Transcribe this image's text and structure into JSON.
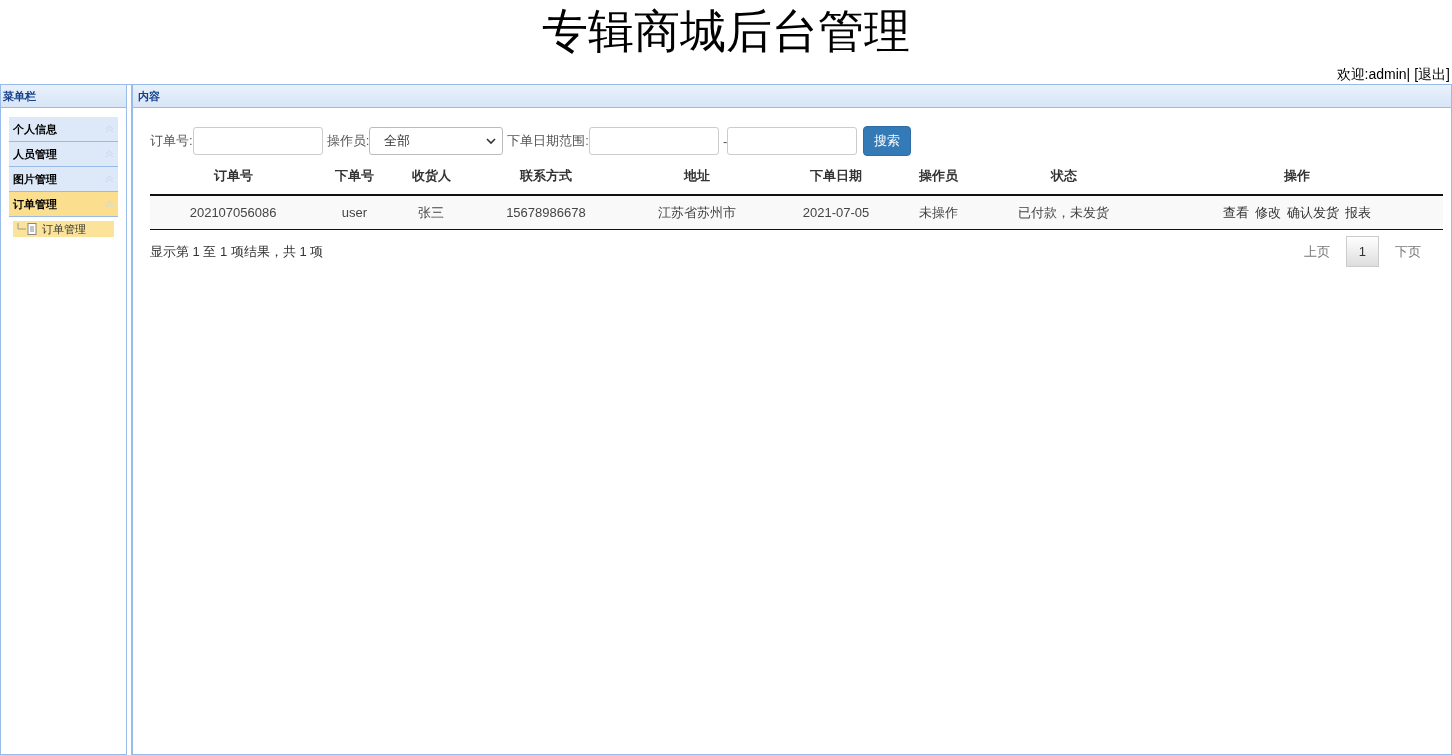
{
  "header": {
    "title": "专辑商城后台管理",
    "welcome": "欢迎:admin|",
    "logout": "[退出]"
  },
  "sidebar": {
    "title": "菜单栏",
    "items": [
      {
        "label": "个人信息",
        "selected": false
      },
      {
        "label": "人员管理",
        "selected": false
      },
      {
        "label": "图片管理",
        "selected": false
      },
      {
        "label": "订单管理",
        "selected": true,
        "children": [
          {
            "label": "订单管理",
            "selected": true
          }
        ]
      }
    ]
  },
  "content": {
    "title": "内容",
    "filters": {
      "order_label": "订单号:",
      "operator_label": "操作员:",
      "operator_value": "全部",
      "date_label": "下单日期范围:",
      "date_sep": "-",
      "search": "搜索"
    },
    "table": {
      "columns": [
        "订单号",
        "下单号",
        "收货人",
        "联系方式",
        "地址",
        "下单日期",
        "操作员",
        "状态",
        "操作"
      ],
      "rows": [
        {
          "cells": [
            "202107056086",
            "user",
            "张三",
            "15678986678",
            "江苏省苏州市",
            "2021-07-05",
            "未操作",
            "已付款，未发货"
          ],
          "actions": [
            "查看",
            "修改",
            "确认发货",
            "报表"
          ]
        }
      ]
    },
    "summary": "显示第 1 至 1 项结果，共 1 项",
    "pagination": {
      "prev": "上页",
      "pages": [
        {
          "label": "1",
          "selected": true
        }
      ],
      "next": "下页"
    }
  }
}
